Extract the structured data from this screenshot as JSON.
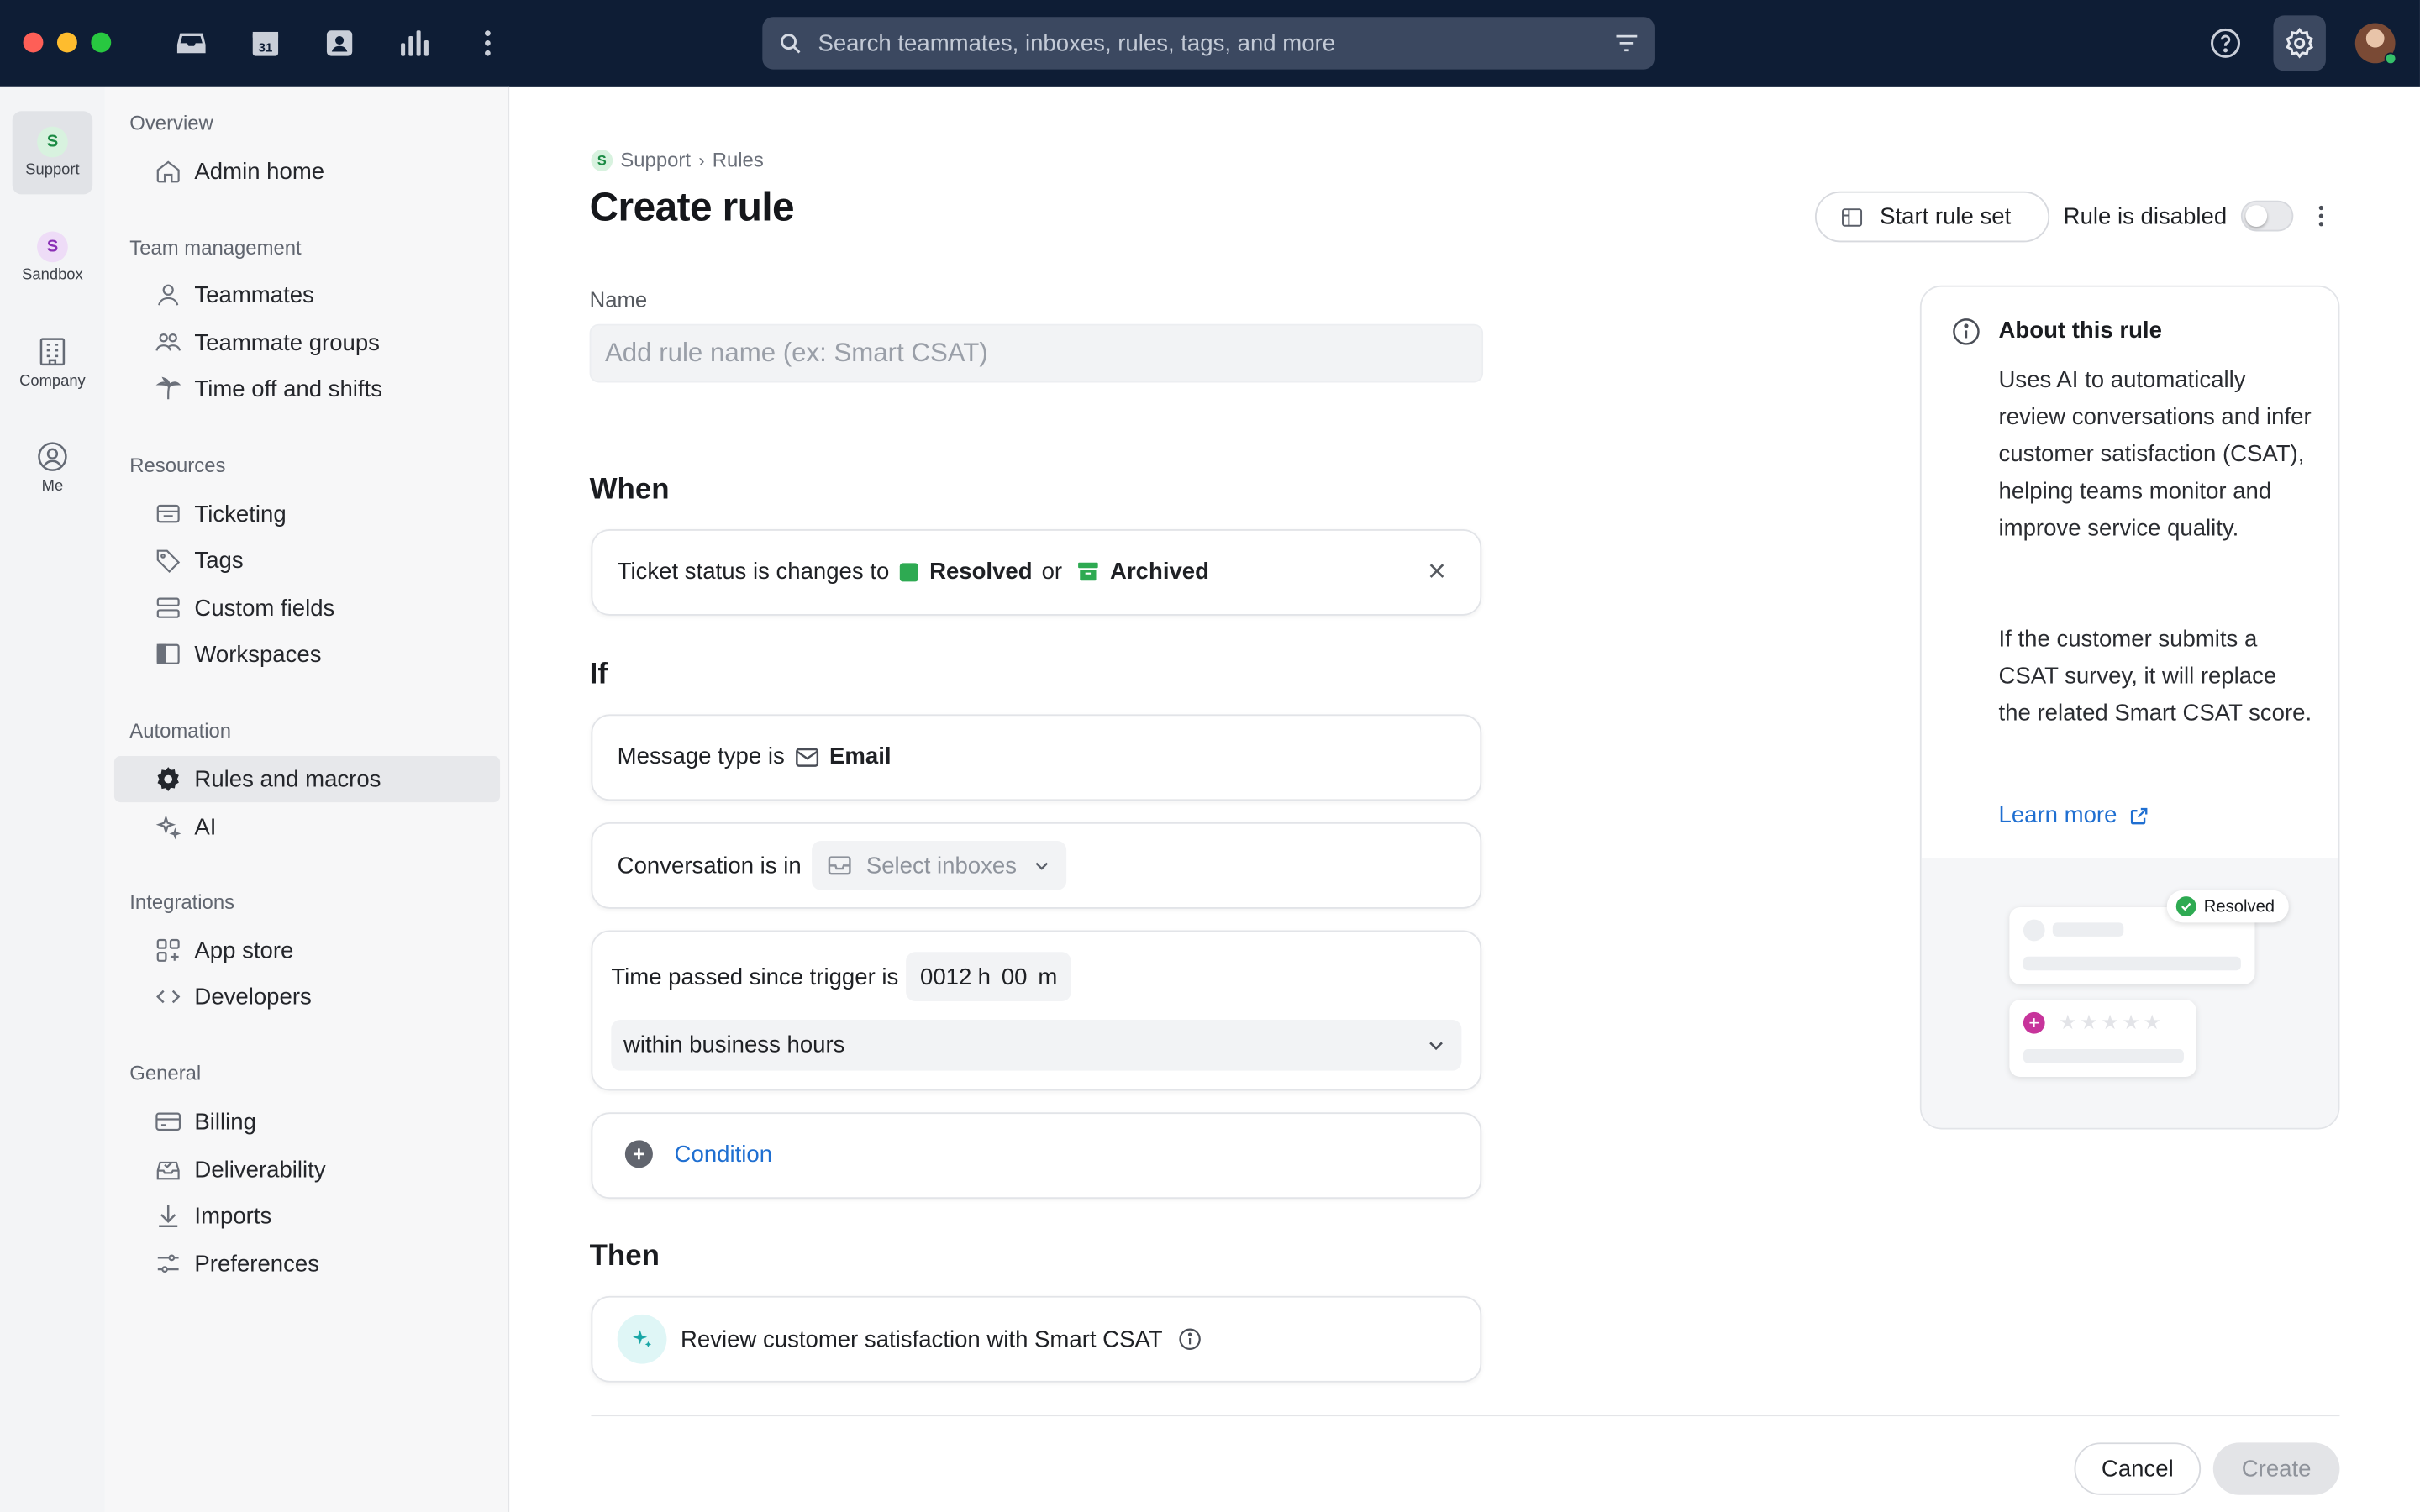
{
  "search": {
    "placeholder": "Search teammates, inboxes, rules, tags, and more"
  },
  "topnav": {
    "calendar_day": "31",
    "icons": [
      "inbox-icon",
      "calendar-icon",
      "contacts-icon",
      "analytics-icon",
      "more-vertical-icon"
    ]
  },
  "rail": {
    "items": [
      {
        "label": "Support",
        "badge": "S",
        "active": true
      },
      {
        "label": "Sandbox",
        "badge": "S"
      },
      {
        "label": "Company"
      },
      {
        "label": "Me"
      }
    ]
  },
  "sidebar": {
    "sections": [
      {
        "title": "Overview",
        "items": [
          "Admin home"
        ]
      },
      {
        "title": "Team management",
        "items": [
          "Teammates",
          "Teammate groups",
          "Time off and shifts"
        ]
      },
      {
        "title": "Resources",
        "items": [
          "Ticketing",
          "Tags",
          "Custom fields",
          "Workspaces"
        ]
      },
      {
        "title": "Automation",
        "items": [
          "Rules and macros",
          "AI"
        ]
      },
      {
        "title": "Integrations",
        "items": [
          "App store",
          "Developers"
        ]
      },
      {
        "title": "General",
        "items": [
          "Billing",
          "Deliverability",
          "Imports",
          "Preferences"
        ]
      }
    ],
    "active_item": "Rules and macros"
  },
  "breadcrumb": {
    "badge": "S",
    "parent": "Support",
    "current": "Rules"
  },
  "page": {
    "title": "Create rule",
    "start_rule_set": "Start rule set",
    "rule_status": "Rule is disabled",
    "rule_enabled": false
  },
  "form": {
    "name_label": "Name",
    "name_placeholder": "Add rule name (ex: Smart CSAT)",
    "when": {
      "heading": "When",
      "trigger_prefix": "Ticket status is changes to",
      "status_1": "Resolved",
      "connector": "or",
      "status_2": "Archived",
      "status_color": "#2eaa52"
    },
    "if": {
      "heading": "If",
      "message_type_prefix": "Message type is",
      "message_type_value": "Email",
      "conversation_prefix": "Conversation is in",
      "inbox_placeholder": "Select inboxes",
      "time_prefix": "Time passed since trigger is",
      "time_hours": "0012",
      "time_h_unit": "h",
      "time_minutes": "00",
      "time_m_unit": "m",
      "business_hours": "within business hours",
      "add_condition": "Condition"
    },
    "then": {
      "heading": "Then",
      "action": "Review customer satisfaction with Smart CSAT"
    }
  },
  "about": {
    "title": "About this rule",
    "paragraph_1": "Uses AI to automatically review conversations and infer customer satisfaction (CSAT), helping teams monitor and improve service quality.",
    "paragraph_2": "If the customer submits a CSAT survey, it will replace the related Smart CSAT score.",
    "learn_more": "Learn more",
    "illustration_badge": "Resolved",
    "illustration_stars": "★★★★★"
  },
  "footer": {
    "cancel": "Cancel",
    "create": "Create"
  },
  "colors": {
    "topbar": "#0e1d35",
    "accent_link": "#1f6fd1",
    "success": "#2eaa52"
  }
}
